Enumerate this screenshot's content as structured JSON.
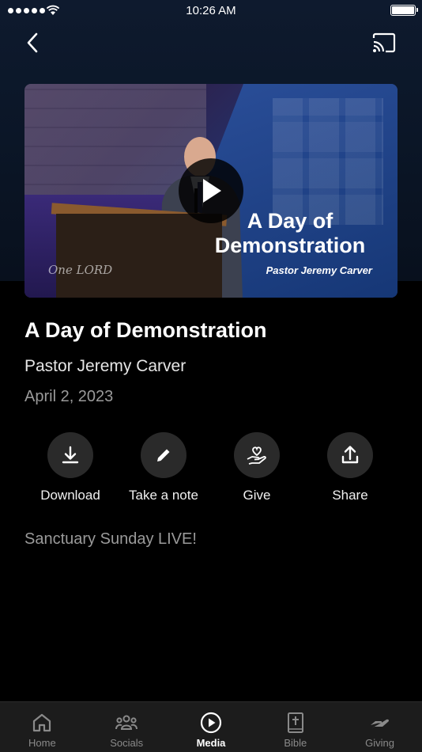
{
  "status_bar": {
    "time": "10:26 AM"
  },
  "video": {
    "thumbnail_title": "A Day of Demonstration",
    "thumbnail_speaker": "Pastor Jeremy Carver",
    "background_text": "One LORD"
  },
  "sermon": {
    "title": "A Day of Demonstration",
    "speaker": "Pastor Jeremy Carver",
    "date": "April 2, 2023",
    "description": "Sanctuary Sunday LIVE!"
  },
  "actions": [
    {
      "label": "Download",
      "icon": "download-icon"
    },
    {
      "label": "Take a note",
      "icon": "pencil-icon"
    },
    {
      "label": "Give",
      "icon": "hand-heart-icon"
    },
    {
      "label": "Share",
      "icon": "share-icon"
    }
  ],
  "tabs": [
    {
      "label": "Home",
      "icon": "home-icon",
      "active": false
    },
    {
      "label": "Socials",
      "icon": "people-icon",
      "active": false
    },
    {
      "label": "Media",
      "icon": "play-circle-icon",
      "active": true
    },
    {
      "label": "Bible",
      "icon": "bible-icon",
      "active": false
    },
    {
      "label": "Giving",
      "icon": "giving-hand-icon",
      "active": false
    }
  ],
  "colors": {
    "background": "#000000",
    "tab_bar": "#1c1c1c",
    "action_circle": "#2a2a2a",
    "muted_text": "#9a9a9a"
  }
}
